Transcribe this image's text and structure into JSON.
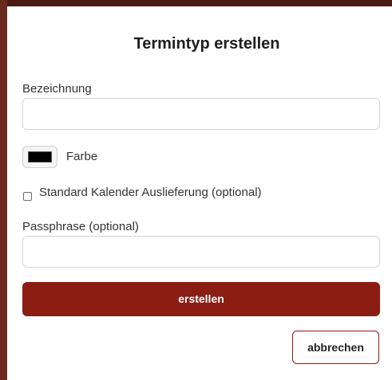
{
  "dialog": {
    "title": "Termintyp erstellen"
  },
  "form": {
    "name_label": "Bezeichnung",
    "name_value": "",
    "color_label": "Farbe",
    "color_value": "#000000",
    "checkbox_label": "Standard Kalender Auslieferung (optional)",
    "checkbox_checked": false,
    "passphrase_label": "Passphrase (optional)",
    "passphrase_value": ""
  },
  "actions": {
    "create_label": "erstellen",
    "cancel_label": "abbrechen"
  },
  "colors": {
    "accent": "#8b1d12",
    "backdrop": "#6b2a20"
  }
}
